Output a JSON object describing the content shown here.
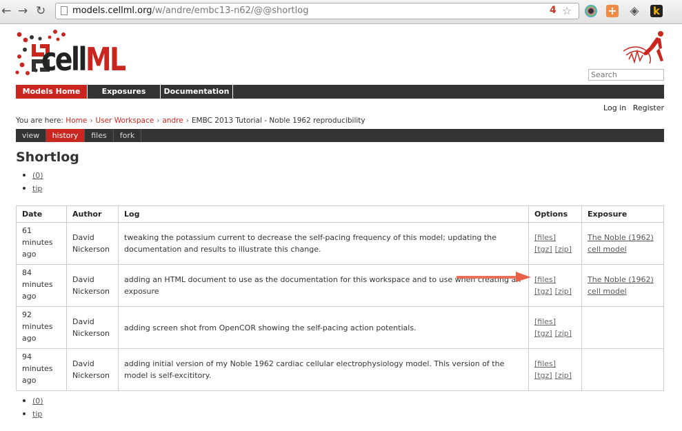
{
  "browser": {
    "back_label": "←",
    "forward_label": "→",
    "reload_label": "↻",
    "url_host": "models.cellml.org",
    "url_path": "/w/andre/embc13-n62/@@shortlog",
    "bookmark_count": "4",
    "bookmark_icon": "star-icon"
  },
  "site": {
    "logo_text_cell": "cell",
    "logo_text_ml": "ML",
    "search_placeholder": "Search",
    "brand_red": "#c8261f"
  },
  "main_nav": [
    {
      "label": "Models Home",
      "active": true
    },
    {
      "label": "Exposures",
      "active": false
    },
    {
      "label": "Documentation",
      "active": false
    }
  ],
  "user_links": {
    "login": "Log in",
    "register": "Register"
  },
  "breadcrumb": {
    "prefix": "You are here:",
    "items": [
      "Home",
      "User Workspace",
      "andre"
    ],
    "current": "EMBC 2013 Tutorial - Noble 1962 reproducibility"
  },
  "sub_tabs": [
    {
      "label": "view",
      "active": false
    },
    {
      "label": "history",
      "active": true
    },
    {
      "label": "files",
      "active": false
    },
    {
      "label": "fork",
      "active": false
    }
  ],
  "page_title": "Shortlog",
  "pager": {
    "first": "(0)",
    "tip": "tip"
  },
  "table": {
    "headers": [
      "Date",
      "Author",
      "Log",
      "Options",
      "Exposure"
    ],
    "rows": [
      {
        "date": "61 minutes ago",
        "author": "David Nickerson",
        "log": "tweaking the potassium current to decrease the self-pacing frequency of this model; updating the documentation and results to illustrate this change.",
        "options": [
          "[files]",
          "[tgz]",
          "[zip]"
        ],
        "exposure": "The Noble (1962) cell model"
      },
      {
        "date": "84 minutes ago",
        "author": "David Nickerson",
        "log": "adding an HTML document to use as the documentation for this workspace and to use when creating an exposure",
        "options": [
          "[files]",
          "[tgz]",
          "[zip]"
        ],
        "exposure": "The Noble (1962) cell model"
      },
      {
        "date": "92 minutes ago",
        "author": "David Nickerson",
        "log": "adding screen shot from OpenCOR showing the self-pacing action potentials.",
        "options": [
          "[files]",
          "[tgz]",
          "[zip]"
        ],
        "exposure": ""
      },
      {
        "date": "94 minutes ago",
        "author": "David Nickerson",
        "log": "adding initial version of my Noble 1962 cardiac cellular electrophysiology model. This version of the model is self-excititory.",
        "options": [
          "[files]",
          "[tgz]",
          "[zip]"
        ],
        "exposure": ""
      }
    ]
  },
  "annotation": {
    "arrow_color": "#e8624a"
  }
}
